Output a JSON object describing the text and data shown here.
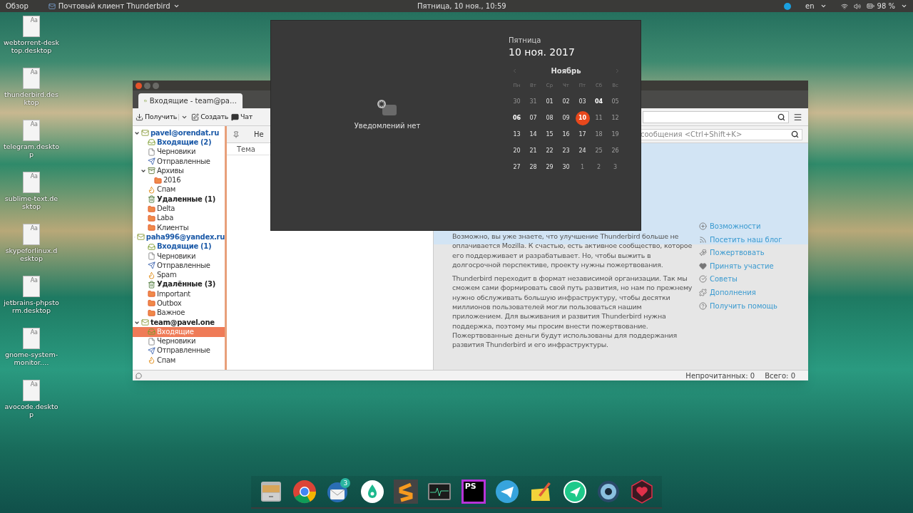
{
  "top_bar": {
    "overview": "Обзор",
    "app_menu": "Почтовый клиент Thunderbird",
    "clock": "Пятница, 10 ноя., 10:59",
    "language": "en",
    "battery": "98 %"
  },
  "desktop_icons": [
    {
      "glyph": "Aa",
      "label": "webtorrent-desktop.desktop"
    },
    {
      "glyph": "Aa",
      "label": "thunderbird.desktop"
    },
    {
      "glyph": "Aa",
      "label": "telegram.desktop"
    },
    {
      "glyph": "Aa",
      "label": "sublime-text.desktop"
    },
    {
      "glyph": "Aa",
      "label": "skypeforlinux.desktop"
    },
    {
      "glyph": "Aa",
      "label": "jetbrains-phpstorm.desktop"
    },
    {
      "glyph": "Aa",
      "label": "gnome-system-monitor.…"
    },
    {
      "glyph": "Aa",
      "label": "avocode.desktop"
    }
  ],
  "mail_window": {
    "tab": "Входящие - team@pa…",
    "toolbar": [
      {
        "kind": "get",
        "label": "Получить"
      },
      {
        "kind": "dropdown"
      },
      {
        "kind": "write",
        "label": "Создать"
      },
      {
        "kind": "chat",
        "label": "Чат"
      }
    ],
    "folders": [
      {
        "label": "pavel@orendat.ru",
        "kind": "account",
        "expanded": true,
        "children": [
          {
            "label": "Входящие (2)",
            "kind": "inbox",
            "unread": true,
            "selected": false
          },
          {
            "label": "Черновики",
            "kind": "drafts",
            "unread": false,
            "selected": false
          },
          {
            "label": "Отправленные",
            "kind": "sent",
            "unread": false,
            "selected": false
          },
          {
            "label": "Архивы",
            "kind": "archive",
            "unread": false,
            "selected": false,
            "expanded": true,
            "children": [
              {
                "label": "2016",
                "kind": "folder",
                "unread": false,
                "selected": false
              }
            ]
          },
          {
            "label": "Спам",
            "kind": "spam",
            "unread": false,
            "selected": false
          },
          {
            "label": "Удаленные (1)",
            "kind": "trash",
            "unread": false,
            "bold": true,
            "selected": false
          },
          {
            "label": "Delta",
            "kind": "folder",
            "unread": false,
            "selected": false
          },
          {
            "label": "Laba",
            "kind": "folder",
            "unread": false,
            "selected": false
          },
          {
            "label": "Клиенты",
            "kind": "folder",
            "unread": false,
            "selected": false
          }
        ]
      },
      {
        "label": "paha996@yandex.ru",
        "kind": "account",
        "expanded": true,
        "children": [
          {
            "label": "Входящие (1)",
            "kind": "inbox",
            "unread": true,
            "selected": false
          },
          {
            "label": "Черновики",
            "kind": "drafts",
            "unread": false,
            "selected": false
          },
          {
            "label": "Отправленные",
            "kind": "sent",
            "unread": false,
            "selected": false
          },
          {
            "label": "Spam",
            "kind": "spam",
            "unread": false,
            "selected": false
          },
          {
            "label": "Удалённые (3)",
            "kind": "trash",
            "unread": false,
            "bold": true,
            "selected": false
          },
          {
            "label": "Important",
            "kind": "folder",
            "unread": false,
            "selected": false
          },
          {
            "label": "Outbox",
            "kind": "folder",
            "unread": false,
            "selected": false
          },
          {
            "label": "Важное",
            "kind": "folder",
            "unread": false,
            "selected": false
          }
        ]
      },
      {
        "label": "team@pavel.one",
        "kind": "account",
        "expanded": true,
        "plain": true,
        "children": [
          {
            "label": "Входящие",
            "kind": "inbox",
            "unread": false,
            "selected": true
          },
          {
            "label": "Черновики",
            "kind": "drafts",
            "unread": false,
            "selected": false
          },
          {
            "label": "Отправленные",
            "kind": "sent",
            "unread": false,
            "selected": false
          },
          {
            "label": "Спам",
            "kind": "spam",
            "unread": false,
            "selected": false
          }
        ]
      }
    ],
    "filter_button": "Не",
    "filter_placeholder": "сообщения <Ctrl+Shift+K>",
    "column": "Тема",
    "paragraphs": [
      "Возможно, вы уже знаете, что улучшение Thunderbird больше не оплачивается Mozilla. К счастью, есть активное сообщество, которое его поддерживает и разрабатывает. Но, чтобы выжить в долгосрочной перспективе, проекту нужны пожертвования.",
      "Thunderbird переходит в формат независимой организации. Так мы сможем сами формировать свой путь развития, но нам по прежнему нужно обслуживать большую инфраструктуру, чтобы десятки миллионов пользователей могли пользоваться нашим приложением. Для выживания и развития Thunderbird нужна поддержка, поэтому мы просим внести пожертвование. Пожертвованные деньги будут использованы для поддержания развития Thunderbird и его инфраструктуры."
    ],
    "links": [
      {
        "kind": "features",
        "label": "Возможности"
      },
      {
        "kind": "blog",
        "label": "Посетить наш блог"
      },
      {
        "kind": "donate",
        "label": "Пожертвовать"
      },
      {
        "kind": "involved",
        "label": "Принять участие"
      },
      {
        "kind": "tips",
        "label": "Советы"
      },
      {
        "kind": "addons",
        "label": "Дополнения"
      },
      {
        "kind": "help",
        "label": "Получить помощь"
      }
    ],
    "status": [
      "Непрочитанных: 0",
      "Всего: 0"
    ]
  },
  "popup": {
    "empty": "Уведомлений нет",
    "weekday": "Пятница",
    "date": "10 ноя. 2017",
    "month": "Ноябрь",
    "weekdays": [
      "Пн",
      "Вт",
      "Ср",
      "Чт",
      "Пт",
      "Сб",
      "Вс"
    ],
    "days": [
      {
        "label": "30",
        "kind": "other",
        "bold": false,
        "selected": false
      },
      {
        "label": "31",
        "kind": "other",
        "bold": false,
        "selected": false
      },
      {
        "label": "01",
        "kind": "current",
        "bold": false,
        "selected": false
      },
      {
        "label": "02",
        "kind": "current",
        "bold": false,
        "selected": false
      },
      {
        "label": "03",
        "kind": "current",
        "bold": false,
        "selected": false
      },
      {
        "label": "04",
        "kind": "current",
        "bold": true,
        "selected": false
      },
      {
        "label": "05",
        "kind": "weekend",
        "bold": false,
        "selected": false
      },
      {
        "label": "06",
        "kind": "current",
        "bold": true,
        "selected": false
      },
      {
        "label": "07",
        "kind": "current",
        "bold": false,
        "selected": false
      },
      {
        "label": "08",
        "kind": "current",
        "bold": false,
        "selected": false
      },
      {
        "label": "09",
        "kind": "current",
        "bold": false,
        "selected": false
      },
      {
        "label": "10",
        "kind": "current",
        "bold": true,
        "selected": true
      },
      {
        "label": "11",
        "kind": "weekend",
        "bold": false,
        "selected": false
      },
      {
        "label": "12",
        "kind": "weekend",
        "bold": false,
        "selected": false
      },
      {
        "label": "13",
        "kind": "current",
        "bold": false,
        "selected": false
      },
      {
        "label": "14",
        "kind": "current",
        "bold": false,
        "selected": false
      },
      {
        "label": "15",
        "kind": "current",
        "bold": false,
        "selected": false
      },
      {
        "label": "16",
        "kind": "current",
        "bold": false,
        "selected": false
      },
      {
        "label": "17",
        "kind": "current",
        "bold": false,
        "selected": false
      },
      {
        "label": "18",
        "kind": "weekend",
        "bold": false,
        "selected": false
      },
      {
        "label": "19",
        "kind": "weekend",
        "bold": false,
        "selected": false
      },
      {
        "label": "20",
        "kind": "current",
        "bold": false,
        "selected": false
      },
      {
        "label": "21",
        "kind": "current",
        "bold": false,
        "selected": false
      },
      {
        "label": "22",
        "kind": "current",
        "bold": false,
        "selected": false
      },
      {
        "label": "23",
        "kind": "current",
        "bold": false,
        "selected": false
      },
      {
        "label": "24",
        "kind": "current",
        "bold": false,
        "selected": false
      },
      {
        "label": "25",
        "kind": "weekend",
        "bold": false,
        "selected": false
      },
      {
        "label": "26",
        "kind": "weekend",
        "bold": false,
        "selected": false
      },
      {
        "label": "27",
        "kind": "current",
        "bold": false,
        "selected": false
      },
      {
        "label": "28",
        "kind": "current",
        "bold": false,
        "selected": false
      },
      {
        "label": "29",
        "kind": "current",
        "bold": false,
        "selected": false
      },
      {
        "label": "30",
        "kind": "current",
        "bold": false,
        "selected": false
      },
      {
        "label": "1",
        "kind": "other",
        "bold": false,
        "selected": false
      },
      {
        "label": "2",
        "kind": "other",
        "bold": false,
        "selected": false
      },
      {
        "label": "3",
        "kind": "other",
        "bold": false,
        "selected": false
      }
    ]
  },
  "dock": [
    {
      "kind": "cabinet"
    },
    {
      "kind": "ring"
    },
    {
      "kind": "mail",
      "badge": "3"
    },
    {
      "kind": "drop"
    },
    {
      "kind": "zigzag"
    },
    {
      "kind": "monitor"
    },
    {
      "kind": "ps",
      "text": "PS"
    },
    {
      "kind": "plane"
    },
    {
      "kind": "notepad"
    },
    {
      "kind": "plane-circle"
    },
    {
      "kind": "shutter"
    },
    {
      "kind": "heart"
    }
  ]
}
